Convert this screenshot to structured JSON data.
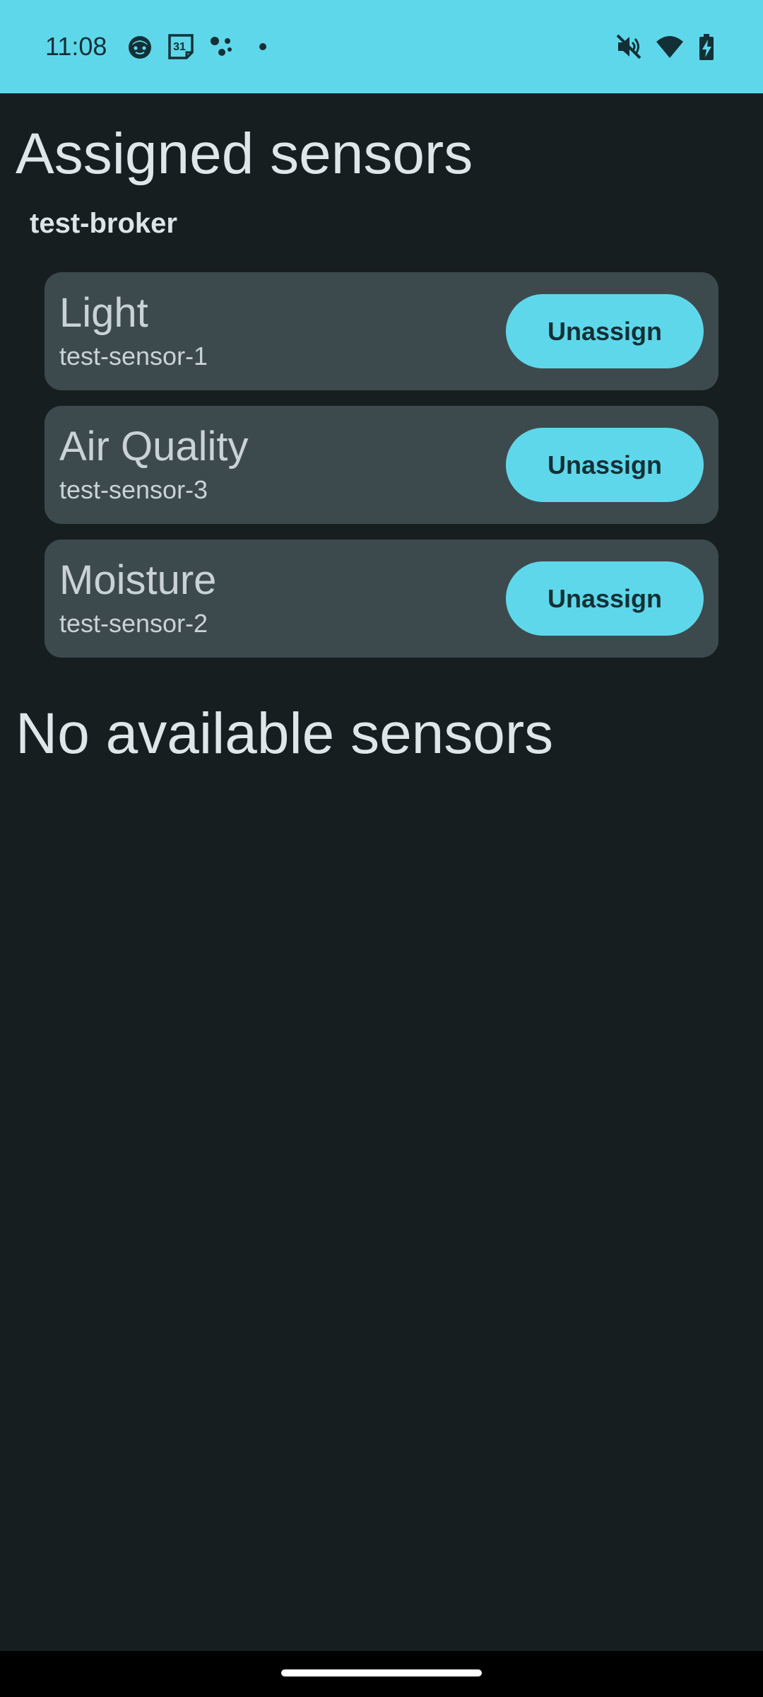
{
  "status_bar": {
    "time": "11:08",
    "calendar_day": "31",
    "left_icons": [
      "face-icon",
      "calendar-icon",
      "assistant-icon",
      "notification-dot-icon"
    ],
    "right_icons": [
      "mute-icon",
      "wifi-icon",
      "battery-charging-icon"
    ],
    "background_color": "#5fd7ea"
  },
  "assigned": {
    "title": "Assigned sensors",
    "broker": "test-broker",
    "sensors": [
      {
        "type": "Light",
        "id": "test-sensor-1",
        "action": "Unassign"
      },
      {
        "type": "Air Quality",
        "id": "test-sensor-3",
        "action": "Unassign"
      },
      {
        "type": "Moisture",
        "id": "test-sensor-2",
        "action": "Unassign"
      }
    ]
  },
  "available": {
    "title": "No available sensors"
  },
  "colors": {
    "background": "#171e20",
    "card": "#3d4a4d",
    "accent": "#5fd7ea",
    "text": "#dde6e8"
  }
}
